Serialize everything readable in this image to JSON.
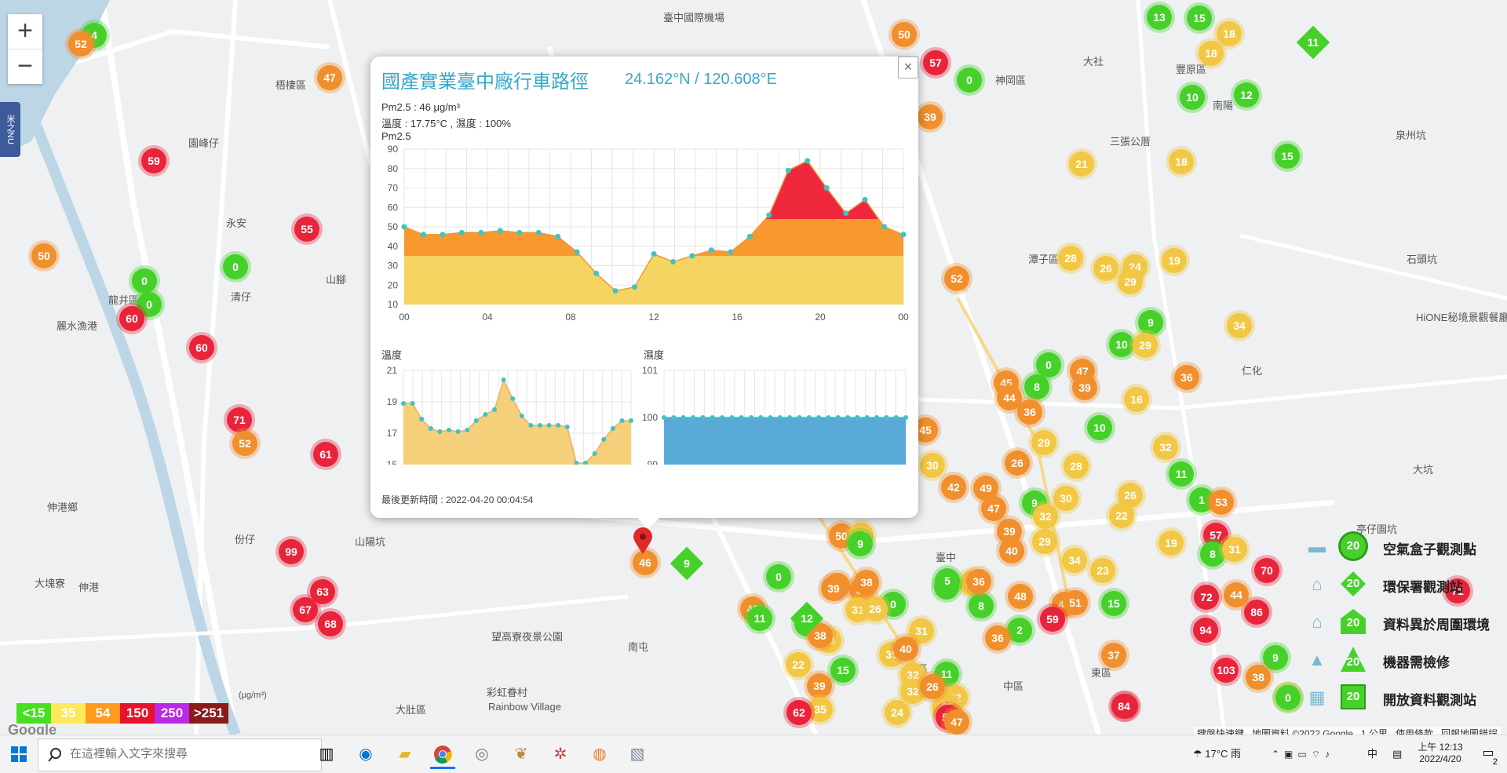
{
  "map": {
    "zoom_in": "+",
    "zoom_out": "−",
    "side_tab": "米之NU",
    "place_labels": [
      {
        "t": "臺中國際機場"
      },
      {
        "t": "梧棲區"
      },
      {
        "t": "園峰仔"
      },
      {
        "t": "永安"
      },
      {
        "t": "清仔"
      },
      {
        "t": "龍井區"
      },
      {
        "t": "麗水漁港"
      },
      {
        "t": "山腳"
      },
      {
        "t": "伸港鄉"
      },
      {
        "t": "份仔"
      },
      {
        "t": "大肚區"
      },
      {
        "t": "山陽坑"
      },
      {
        "t": "伸港"
      },
      {
        "t": "大塊寮"
      },
      {
        "t": "神岡區"
      },
      {
        "t": "豐原區"
      },
      {
        "t": "潭子區"
      },
      {
        "t": "大坑"
      },
      {
        "t": "臺中"
      },
      {
        "t": "南屯"
      },
      {
        "t": "中區"
      },
      {
        "t": "東區"
      },
      {
        "t": "西區"
      },
      {
        "t": "泉州坑"
      },
      {
        "t": "石頭坑"
      },
      {
        "t": "大社"
      },
      {
        "t": "三張公厝"
      },
      {
        "t": "彩虹眷村"
      },
      {
        "t": "Rainbow Village"
      },
      {
        "t": "望高寮夜景公園"
      },
      {
        "t": "HiONE秘境景觀餐廳"
      },
      {
        "t": "亭仔園坑"
      },
      {
        "t": "仁化"
      },
      {
        "t": "南陽"
      },
      {
        "t": "大肚"
      }
    ],
    "markers": [
      {
        "v": "4",
        "c": "g"
      },
      {
        "v": "52",
        "c": "o"
      },
      {
        "v": "47",
        "c": "o"
      },
      {
        "v": "59",
        "c": "r"
      },
      {
        "v": "50",
        "c": "o"
      },
      {
        "v": "55",
        "c": "r"
      },
      {
        "v": "0",
        "c": "g"
      },
      {
        "v": "0",
        "c": "g"
      },
      {
        "v": "0",
        "c": "g"
      },
      {
        "v": "60",
        "c": "r"
      },
      {
        "v": "60",
        "c": "r"
      },
      {
        "v": "71",
        "c": "r"
      },
      {
        "v": "52",
        "c": "o"
      },
      {
        "v": "61",
        "c": "r"
      },
      {
        "v": "99",
        "c": "r"
      },
      {
        "v": "63",
        "c": "r"
      },
      {
        "v": "67",
        "c": "r"
      },
      {
        "v": "68",
        "c": "r"
      },
      {
        "v": "50",
        "c": "o"
      },
      {
        "v": "57",
        "c": "r"
      },
      {
        "v": "0",
        "c": "g"
      },
      {
        "v": "39",
        "c": "o"
      },
      {
        "v": "13",
        "c": "g"
      },
      {
        "v": "15",
        "c": "g"
      },
      {
        "v": "18",
        "c": "y"
      },
      {
        "v": "18",
        "c": "y"
      },
      {
        "v": "10",
        "c": "g"
      },
      {
        "v": "12",
        "c": "g"
      },
      {
        "v": "15",
        "c": "g"
      },
      {
        "v": "21",
        "c": "y"
      },
      {
        "v": "18",
        "c": "y"
      },
      {
        "v": "28",
        "c": "y"
      },
      {
        "v": "26",
        "c": "y"
      },
      {
        "v": "24",
        "c": "y"
      },
      {
        "v": "29",
        "c": "y"
      },
      {
        "v": "19",
        "c": "y"
      },
      {
        "v": "52",
        "c": "o"
      },
      {
        "v": "9",
        "c": "g"
      },
      {
        "v": "34",
        "c": "y"
      },
      {
        "v": "10",
        "c": "g"
      },
      {
        "v": "29",
        "c": "y"
      },
      {
        "v": "36",
        "c": "o"
      },
      {
        "v": "0",
        "c": "g"
      },
      {
        "v": "47",
        "c": "o"
      },
      {
        "v": "45",
        "c": "o"
      },
      {
        "v": "8",
        "c": "g"
      },
      {
        "v": "39",
        "c": "o"
      },
      {
        "v": "44",
        "c": "o"
      },
      {
        "v": "36",
        "c": "o"
      },
      {
        "v": "16",
        "c": "y"
      },
      {
        "v": "10",
        "c": "g"
      },
      {
        "v": "29",
        "c": "y"
      },
      {
        "v": "32",
        "c": "y"
      },
      {
        "v": "45",
        "c": "o"
      },
      {
        "v": "30",
        "c": "y"
      },
      {
        "v": "26",
        "c": "o"
      },
      {
        "v": "28",
        "c": "y"
      },
      {
        "v": "11",
        "c": "g"
      },
      {
        "v": "42",
        "c": "o"
      },
      {
        "v": "49",
        "c": "o"
      },
      {
        "v": "47",
        "c": "o"
      },
      {
        "v": "9",
        "c": "g"
      },
      {
        "v": "30",
        "c": "y"
      },
      {
        "v": "26",
        "c": "y"
      },
      {
        "v": "1",
        "c": "g"
      },
      {
        "v": "53",
        "c": "o"
      },
      {
        "v": "32",
        "c": "y"
      },
      {
        "v": "22",
        "c": "y"
      },
      {
        "v": "39",
        "c": "o"
      },
      {
        "v": "40",
        "c": "o"
      },
      {
        "v": "29",
        "c": "y"
      },
      {
        "v": "34",
        "c": "y"
      },
      {
        "v": "19",
        "c": "y"
      },
      {
        "v": "57",
        "c": "r"
      },
      {
        "v": "8",
        "c": "g"
      },
      {
        "v": "31",
        "c": "y"
      },
      {
        "v": "70",
        "c": "r"
      },
      {
        "v": "23",
        "c": "y"
      },
      {
        "v": "38",
        "c": "o"
      },
      {
        "v": "50",
        "c": "o"
      },
      {
        "v": "26",
        "c": "y"
      },
      {
        "v": "9",
        "c": "g"
      },
      {
        "v": "32",
        "c": "y"
      },
      {
        "v": "46",
        "c": "o"
      },
      {
        "v": "31",
        "c": "y"
      },
      {
        "v": "33",
        "c": "y"
      },
      {
        "v": "0",
        "c": "g"
      },
      {
        "v": "0",
        "c": "g"
      },
      {
        "v": "39",
        "c": "o"
      },
      {
        "v": "38",
        "c": "o"
      },
      {
        "v": "26",
        "c": "y"
      },
      {
        "v": "8",
        "c": "g"
      },
      {
        "v": "3",
        "c": "g"
      },
      {
        "v": "5",
        "c": "g"
      },
      {
        "v": "36",
        "c": "o"
      },
      {
        "v": "48",
        "c": "o"
      },
      {
        "v": "48",
        "c": "o"
      },
      {
        "v": "51",
        "c": "o"
      },
      {
        "v": "15",
        "c": "g"
      },
      {
        "v": "71",
        "c": "r"
      },
      {
        "v": "72",
        "c": "r"
      },
      {
        "v": "94",
        "c": "r"
      },
      {
        "v": "86",
        "c": "r"
      },
      {
        "v": "44",
        "c": "o"
      },
      {
        "v": "45",
        "c": "o"
      },
      {
        "v": "12",
        "c": "g"
      },
      {
        "v": "38",
        "c": "o"
      },
      {
        "v": "31",
        "c": "y"
      },
      {
        "v": "2",
        "c": "g"
      },
      {
        "v": "36",
        "c": "o"
      },
      {
        "v": "59",
        "c": "r"
      },
      {
        "v": "37",
        "c": "o"
      },
      {
        "v": "22",
        "c": "y"
      },
      {
        "v": "15",
        "c": "g"
      },
      {
        "v": "35",
        "c": "y"
      },
      {
        "v": "40",
        "c": "o"
      },
      {
        "v": "32",
        "c": "y"
      },
      {
        "v": "11",
        "c": "g"
      },
      {
        "v": "32",
        "c": "y"
      },
      {
        "v": "22",
        "c": "y"
      },
      {
        "v": "35",
        "c": "y"
      },
      {
        "v": "39",
        "c": "o"
      },
      {
        "v": "24",
        "c": "y"
      },
      {
        "v": "25",
        "c": "y"
      },
      {
        "v": "26",
        "c": "o"
      },
      {
        "v": "35",
        "c": "y"
      },
      {
        "v": "62",
        "c": "r"
      },
      {
        "v": "59",
        "c": "r"
      },
      {
        "v": "72",
        "c": "r"
      },
      {
        "v": "84",
        "c": "r"
      },
      {
        "v": "103",
        "c": "r"
      },
      {
        "v": "9",
        "c": "g"
      },
      {
        "v": "32",
        "c": "y"
      },
      {
        "v": "38",
        "c": "o"
      },
      {
        "v": "0",
        "c": "g"
      },
      {
        "v": "11",
        "c": "g"
      },
      {
        "v": "47",
        "c": "o"
      },
      {
        "v": "50",
        "c": "o"
      }
    ],
    "diamonds": [
      {
        "v": "11",
        "c": "g"
      },
      {
        "v": "9",
        "c": "g"
      },
      {
        "v": "12",
        "c": "g"
      }
    ],
    "selected_marker": "46"
  },
  "popup": {
    "close": "×",
    "title": "國產實業臺中廠行車路徑",
    "coords": "24.162°N / 120.608°E",
    "pm_line": "Pm2.5 : 46 μg/m³",
    "env_line": "溫度 : 17.75°C , 濕度 : 100%",
    "chart_label": "Pm2.5",
    "temp_label": "溫度",
    "hum_label": "濕度",
    "updated": "最後更新時間 : 2022-04-20 00:04:54"
  },
  "chart_data": [
    {
      "type": "area",
      "title": "Pm2.5",
      "x_ticks": [
        "00",
        "04",
        "08",
        "12",
        "16",
        "20",
        "00"
      ],
      "y_ticks": [
        10,
        20,
        30,
        40,
        50,
        60,
        70,
        80,
        90
      ],
      "ylim": [
        10,
        90
      ],
      "values": [
        50,
        46,
        46,
        47,
        47,
        48,
        47,
        47,
        45,
        37,
        26,
        17,
        19,
        36,
        32,
        35,
        38,
        37,
        45,
        56,
        79,
        84,
        70,
        57,
        64,
        50,
        46
      ],
      "thresholds": [
        35,
        54
      ],
      "colors": {
        "low": "#f6d462",
        "mid": "#f8982f",
        "high": "#f0283e",
        "line": "#e89a3a",
        "dot": "#3ec4c4"
      }
    },
    {
      "type": "area",
      "title": "溫度",
      "y_ticks": [
        15,
        17,
        19,
        21
      ],
      "ylim": [
        15,
        21
      ],
      "values": [
        18.9,
        18.9,
        17.9,
        17.3,
        17.1,
        17.2,
        17.1,
        17.2,
        17.8,
        18.2,
        18.5,
        20.4,
        19.2,
        18.1,
        17.5,
        17.5,
        17.5,
        17.5,
        17.4,
        15.1,
        15.1,
        15.7,
        16.6,
        17.3,
        17.8,
        17.8
      ],
      "colors": {
        "fill": "#f6cf7a",
        "line": "#e8b06a",
        "dot": "#3ec4c4"
      }
    },
    {
      "type": "area",
      "title": "濕度",
      "y_ticks": [
        99,
        100,
        101
      ],
      "ylim": [
        99,
        101
      ],
      "values": [
        100,
        100,
        100,
        100,
        100,
        100,
        100,
        100,
        100,
        100,
        100,
        100,
        100,
        100,
        100,
        100,
        100,
        100,
        100,
        100,
        100,
        100,
        100,
        100,
        100,
        100
      ],
      "colors": {
        "fill": "#5aaad8",
        "line": "#3ec4c4",
        "dot": "#3ec4c4"
      }
    }
  ],
  "legend": {
    "items": [
      {
        "label": "空氣盒子觀測點",
        "icon": "home-icon",
        "shape": "circle",
        "value": "20"
      },
      {
        "label": "環保署觀測站",
        "icon": "government-icon",
        "shape": "diamond",
        "value": "20"
      },
      {
        "label": "資料異於周圍環境",
        "icon": "house-icon",
        "shape": "pentagon",
        "value": "20"
      },
      {
        "label": "機器需檢修",
        "icon": "tower-icon",
        "shape": "triangle",
        "value": "20"
      },
      {
        "label": "開放資料觀測站",
        "icon": "building-icon",
        "shape": "square",
        "value": "20"
      }
    ]
  },
  "scale": [
    {
      "t": "<15",
      "bg": "#45e01f"
    },
    {
      "t": "35",
      "bg": "#ffe95a"
    },
    {
      "t": "54",
      "bg": "#ff9a1f"
    },
    {
      "t": "150",
      "bg": "#e8122b"
    },
    {
      "t": "250",
      "bg": "#bb28e6"
    },
    {
      "t": ">251",
      "bg": "#8c1a1a"
    }
  ],
  "scale_unit": "(μg/m³)",
  "google_logo": "Google",
  "map_footer": {
    "shortcuts": "鍵盤快速鍵",
    "attribution": "地圖資料 ©2022 Google",
    "scale": "1 公里",
    "terms": "使用條款",
    "report": "回報地圖錯誤"
  },
  "taskbar": {
    "search_placeholder": "在這裡輸入文字來搜尋",
    "weather": "17°C 雨",
    "ime": "中",
    "time": "上午 12:13",
    "date": "2022/4/20",
    "notifications": "2"
  }
}
